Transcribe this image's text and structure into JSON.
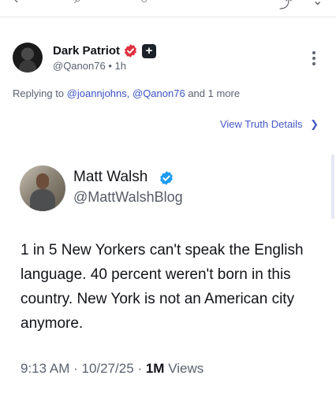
{
  "reply_post": {
    "author_name": "Dark Patriot",
    "handle": "@Qanon76",
    "separator": "•",
    "time": "1h",
    "replying_prefix": "Replying to",
    "mention_1": "@joannjohns,",
    "mention_2": "@Qanon76",
    "replying_suffix": "and 1 more",
    "plus_badge": "+"
  },
  "view_truth": {
    "label": "View Truth Details",
    "chevron": "❯"
  },
  "embedded_post": {
    "author_name": "Matt Walsh",
    "handle": "@MattWalshBlog",
    "text": "1 in 5 New Yorkers can't speak the English language. 40 percent weren't born in this country. New York is not an American city anymore.",
    "time": "9:13 AM",
    "date": "10/27/25",
    "dot": "·",
    "views_count": "1M",
    "views_label": "Views"
  },
  "icons": {
    "verified_red": "verified-badge-red-icon",
    "verified_blue": "verified-badge-blue-icon",
    "more": "more-vertical-icon"
  },
  "colors": {
    "link": "#3b52c4",
    "verified_red": "#e0303f",
    "verified_blue": "#1d9bf0",
    "muted": "#5a6170"
  }
}
